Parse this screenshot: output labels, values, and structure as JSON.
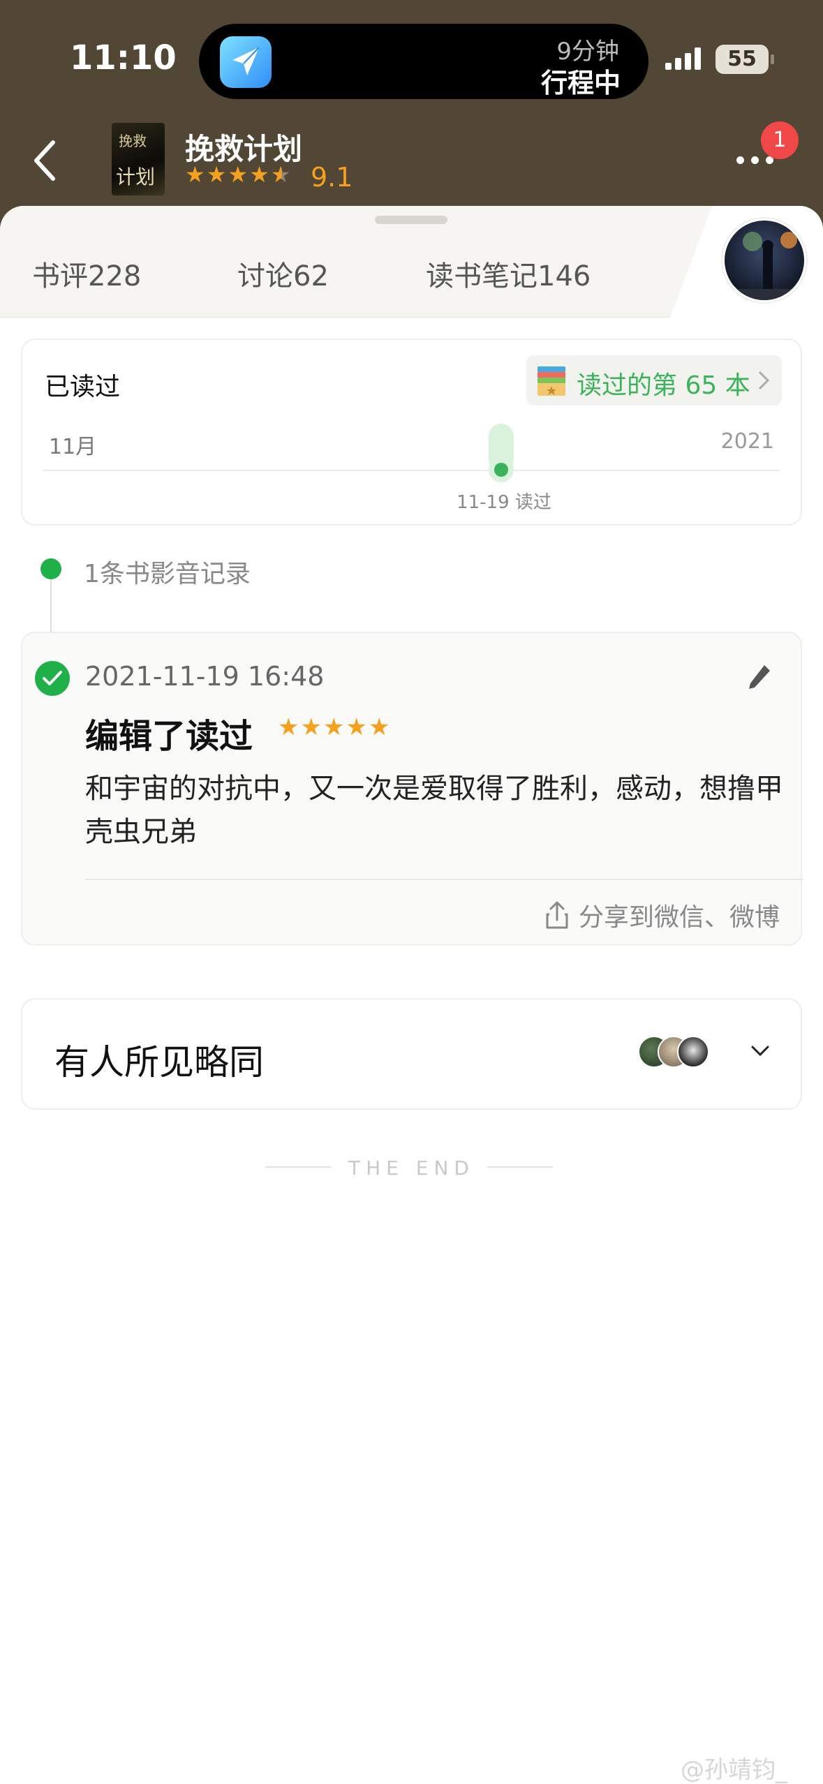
{
  "status_bar": {
    "time": "11:10",
    "island_minutes": "9分钟",
    "island_status": "行程中",
    "battery": "55"
  },
  "header": {
    "book_title": "挽救计划",
    "rating": "9.1",
    "notification_count": "1",
    "cover_text_1": "挽救",
    "cover_text_2": "计划"
  },
  "tabs": [
    {
      "label": "书评228"
    },
    {
      "label": "讨论62"
    },
    {
      "label": "读书笔记146"
    }
  ],
  "read_card": {
    "title": "已读过",
    "count_label": "读过的第 65 本",
    "timeline_month": "11月",
    "timeline_year": "2021",
    "timeline_event": "11-19 读过"
  },
  "records": {
    "count_label": "1条书影音记录"
  },
  "note": {
    "timestamp": "2021-11-19 16:48",
    "title": "编辑了读过",
    "body": "和宇宙的对抗中，又一次是爱取得了胜利，感动，想撸甲壳虫兄弟",
    "share_label": "分享到微信、微博"
  },
  "agree": {
    "label": "有人所见略同"
  },
  "end_label": "THE END",
  "watermark": "@孙靖钧_",
  "colors": {
    "header_bg": "#524634",
    "accent_green": "#1fb04a",
    "star": "#f4a020",
    "badge": "#f04848"
  }
}
